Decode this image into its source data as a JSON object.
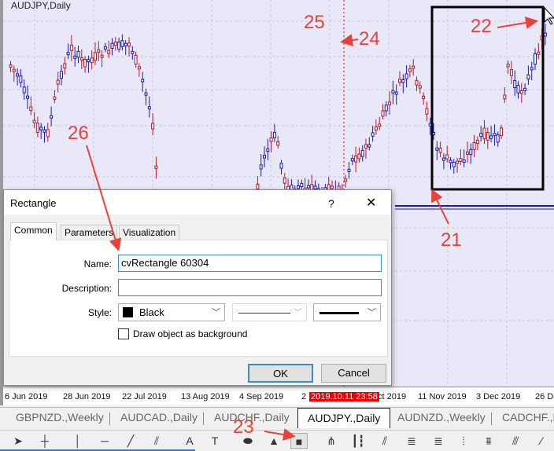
{
  "chart": {
    "title": "AUDJPY,Daily",
    "rect_color": "#000000",
    "bull_color": "#1a1ab0",
    "bear_color": "#b01a2a"
  },
  "axis": {
    "ticks": [
      "6 Jun 2019",
      "28 Jun 2019",
      "22 Jul 2019",
      "13 Aug 2019",
      "4 Sep 2019",
      "2",
      "ct 2019",
      "11 Nov 2019",
      "3 Dec 2019",
      "26 De"
    ],
    "crosshair_time": "2019.10.11 23:58"
  },
  "tabs": [
    {
      "label": "GBPNZD.,Weekly"
    },
    {
      "label": "AUDCAD.,Daily"
    },
    {
      "label": "AUDCHF.,Daily"
    },
    {
      "label": "AUDJPY.,Daily",
      "active": true
    },
    {
      "label": "AUDNZD.,Weekly"
    },
    {
      "label": "CADCHF.,D"
    }
  ],
  "toolbar": {
    "items": [
      "cursor-icon",
      "crosshair-icon",
      "vertical-line-icon",
      "horizontal-line-icon",
      "trendline-icon",
      "channel-icon",
      "text-icon",
      "text-label-icon",
      "ellipse-icon",
      "triangle-icon",
      "rectangle-icon",
      "pitchfork-icon",
      "cycle-lines-icon",
      "gann-line-icon",
      "fibo-retracement-icon",
      "fibo-arcs-icon",
      "fibo-time-icon",
      "gann-grid-icon",
      "gann-fan-icon",
      "fibo-channel-icon"
    ]
  },
  "dialog": {
    "title": "Rectangle",
    "help": "?",
    "close": "✕",
    "tabs": [
      "Common",
      "Parameters",
      "Visualization"
    ],
    "name_label": "Name:",
    "name_value": "cvRectangle 60304",
    "description_label": "Description:",
    "description_value": "",
    "style_label": "Style:",
    "color_value": "Black",
    "color_hex": "#000000",
    "background_label": "Draw object as background",
    "background_checked": false,
    "ok": "OK",
    "cancel": "Cancel"
  },
  "annotations": [
    "25",
    "24",
    "26",
    "21",
    "22",
    "23"
  ]
}
